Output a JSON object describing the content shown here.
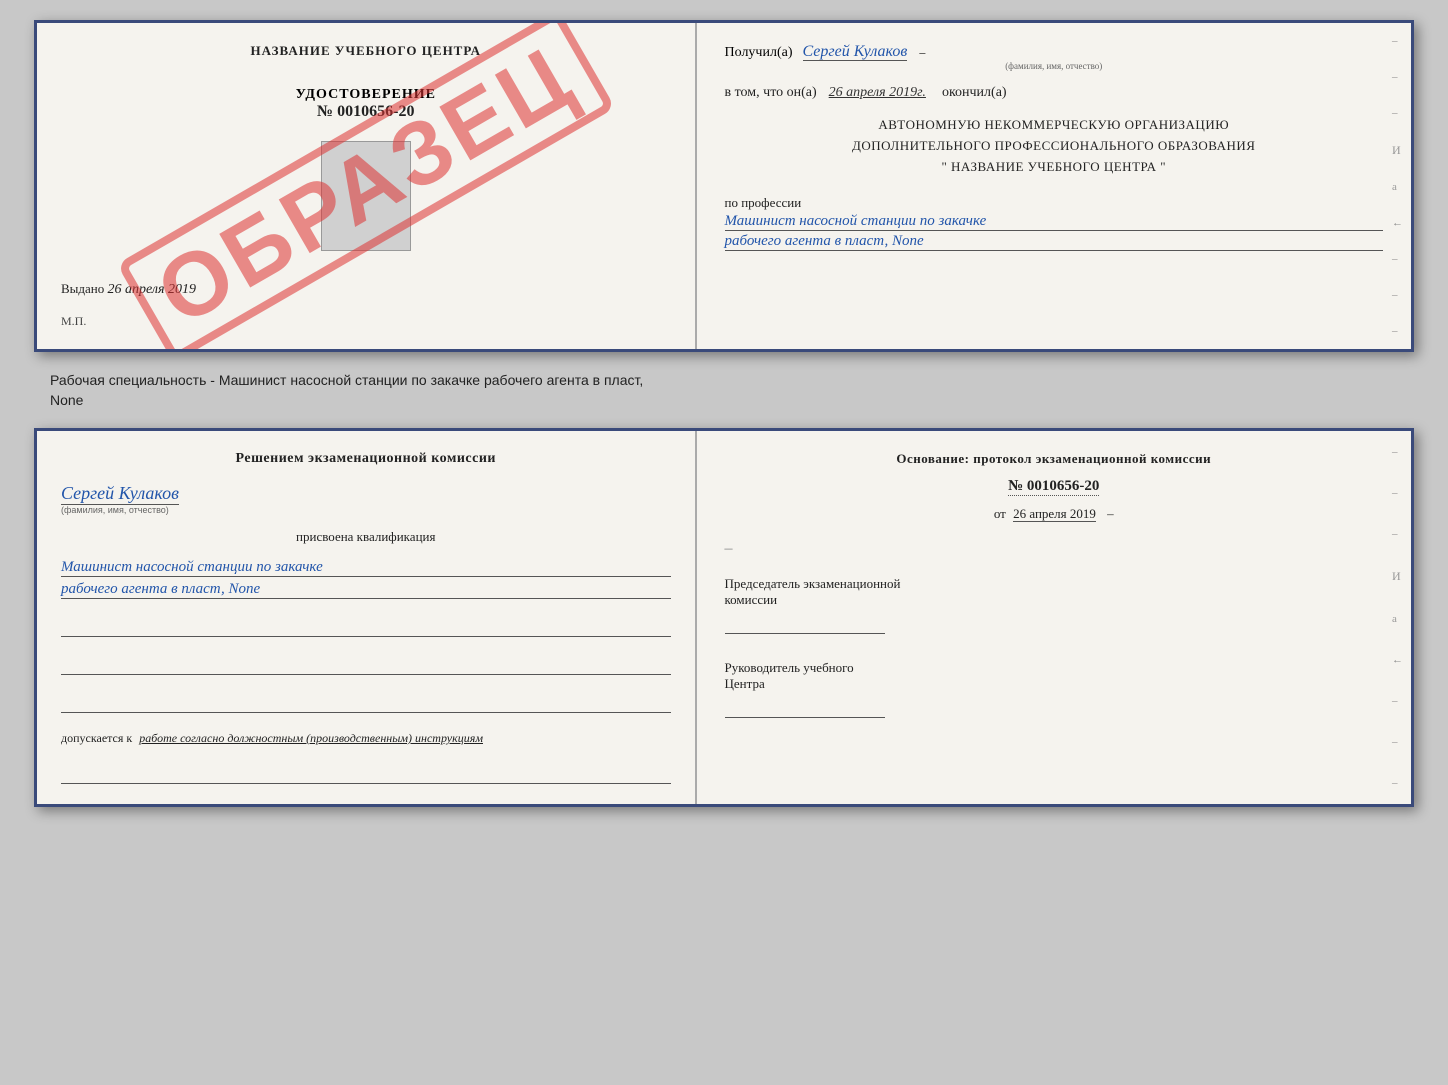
{
  "top_cert": {
    "left": {
      "title": "НАЗВАНИЕ УЧЕБНОГО ЦЕНТРА",
      "watermark": "ОБРАЗЕЦ",
      "cert_label": "УДОСТОВЕРЕНИЕ",
      "cert_number": "№ 0010656-20",
      "issued_prefix": "Выдано",
      "issued_date": "26 апреля 2019",
      "mp_label": "М.П."
    },
    "right": {
      "recipient_prefix": "Получил(а)",
      "recipient_name": "Сергей Кулаков",
      "recipient_hint": "(фамилия, имя, отчество)",
      "date_prefix": "в том, что он(а)",
      "date_value": "26 апреля 2019г.",
      "date_suffix": "окончил(а)",
      "org_line1": "АВТОНОМНУЮ НЕКОММЕРЧЕСКУЮ ОРГАНИЗАЦИЮ",
      "org_line2": "ДОПОЛНИТЕЛЬНОГО ПРОФЕССИОНАЛЬНОГО ОБРАЗОВАНИЯ",
      "org_line3": "\"    НАЗВАНИЕ УЧЕБНОГО ЦЕНТРА    \"",
      "profession_label": "по профессии",
      "profession_line1": "Машинист насосной станции по закачке",
      "profession_line2": "рабочего агента в пласт, None"
    }
  },
  "description": {
    "text": "Рабочая специальность - Машинист насосной станции по закачке рабочего агента в пласт,",
    "text2": "None"
  },
  "bottom_cert": {
    "left": {
      "decision_title": "Решением экзаменационной комиссии",
      "name": "Сергей Кулаков",
      "name_hint": "(фамилия, имя, отчество)",
      "assigned_label": "присвоена квалификация",
      "qualification_line1": "Машинист насосной станции по закачке",
      "qualification_line2": "рабочего агента в пласт, None",
      "допускается_prefix": "допускается к",
      "допускается_text": "работе согласно должностным (производственным) инструкциям"
    },
    "right": {
      "basis_title": "Основание: протокол экзаменационной комиссии",
      "protocol_number": "№ 0010656-20",
      "date_prefix": "от",
      "date_value": "26 апреля 2019",
      "chairman_label": "Председатель экзаменационной",
      "chairman_label2": "комиссии",
      "head_label": "Руководитель учебного",
      "head_label2": "Центра"
    }
  }
}
